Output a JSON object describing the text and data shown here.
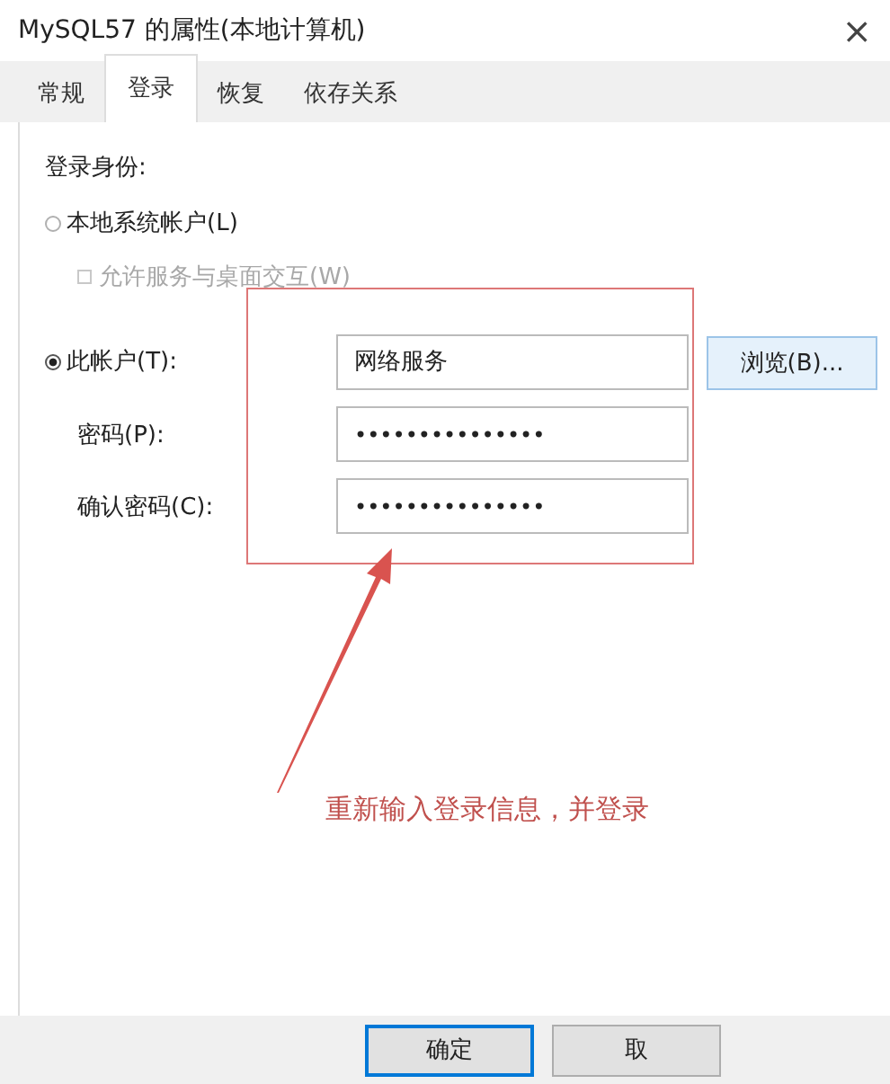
{
  "window": {
    "title": "MySQL57 的属性(本地计算机)",
    "close": "×"
  },
  "tabs": [
    {
      "label": "常规",
      "selected": false
    },
    {
      "label": "登录",
      "selected": true
    },
    {
      "label": "恢复",
      "selected": false
    },
    {
      "label": "依存关系",
      "selected": false
    }
  ],
  "logon": {
    "heading": "登录身份:",
    "local_account": {
      "label": "本地系统帐户(L)",
      "selected": false
    },
    "allow_desktop": {
      "label": "允许服务与桌面交互(W)",
      "checked": false,
      "disabled": true
    },
    "this_account": {
      "label": "此帐户(T):",
      "selected": true,
      "value": "网络服务",
      "browse": "浏览(B)..."
    },
    "password": {
      "label": "密码(P):",
      "value": "•••••••••••••••"
    },
    "confirm": {
      "label": "确认密码(C):",
      "value": "•••••••••••••••"
    }
  },
  "annotation": {
    "note": "重新输入登录信息，并登录"
  },
  "buttons": [
    "确定",
    "取"
  ]
}
